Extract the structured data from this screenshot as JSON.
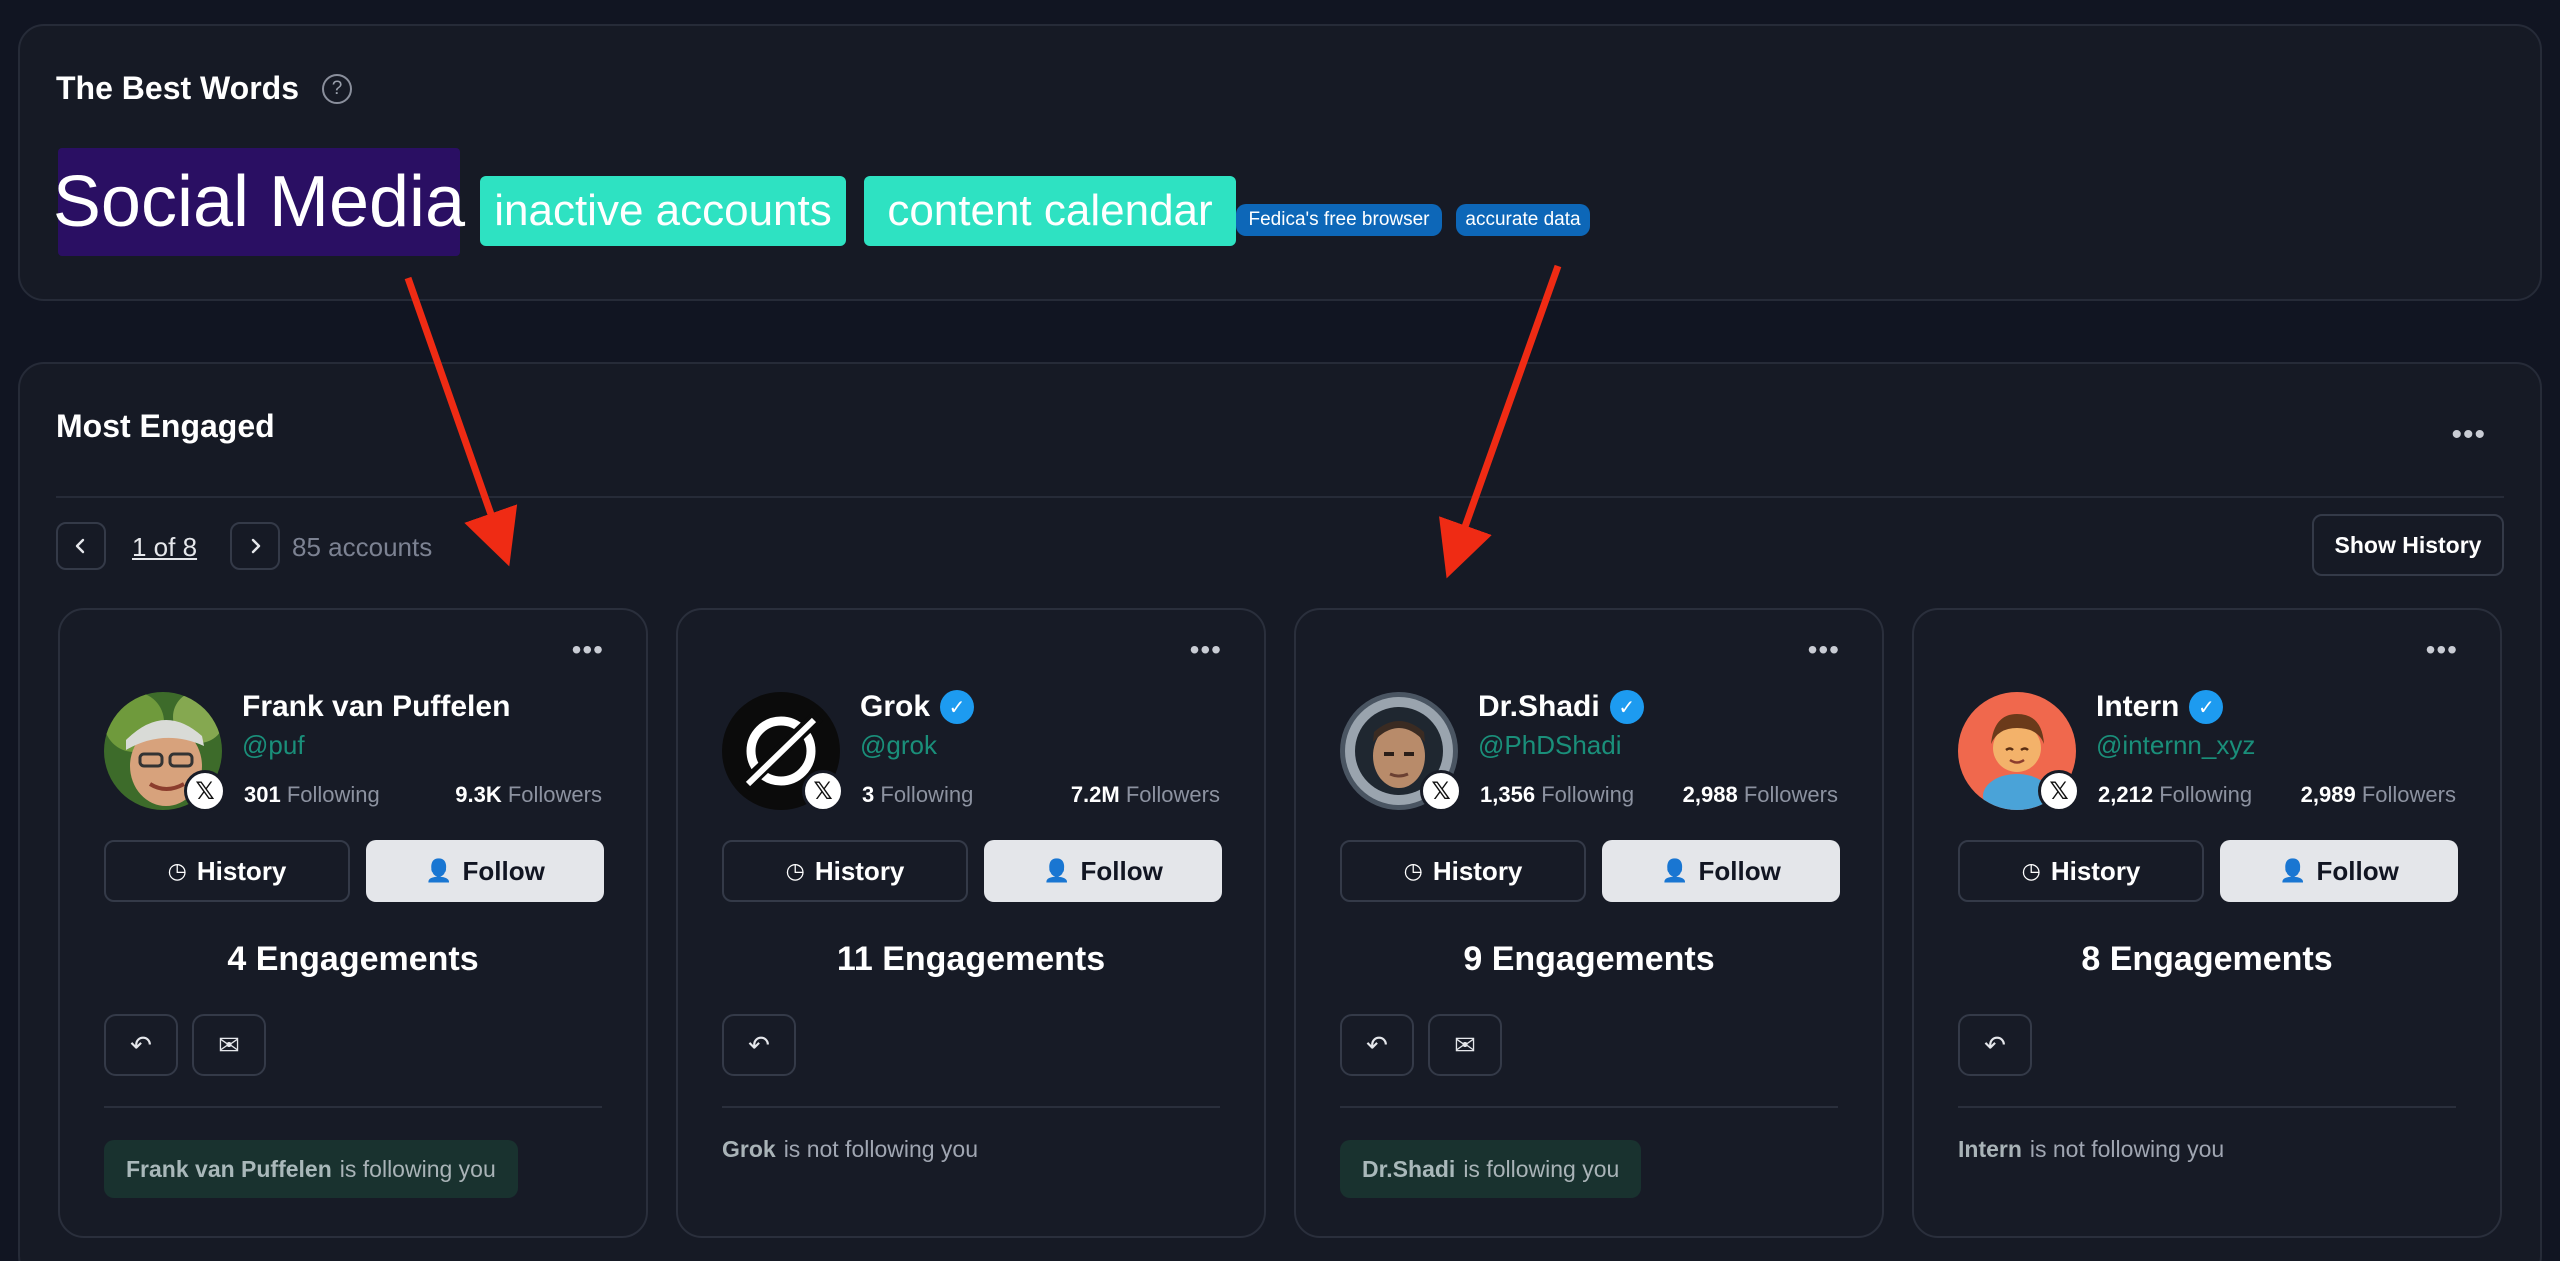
{
  "words_panel": {
    "title": "The Best Words",
    "help_icon": "question-circle-icon",
    "words": [
      {
        "text": "Social Media",
        "bg": "#2a0f63"
      },
      {
        "text": "inactive accounts",
        "bg": "#2ee2c2"
      },
      {
        "text": "content calendar",
        "bg": "#2ee2c2"
      },
      {
        "text": "Fedica's free browser",
        "bg": "#0d67b8"
      },
      {
        "text": "accurate data",
        "bg": "#0d67b8"
      }
    ]
  },
  "engaged_panel": {
    "title": "Most Engaged",
    "menu_icon": "ellipsis-icon",
    "pager": {
      "label": "1 of 8",
      "prev_icon": "chevron-left-icon",
      "next_icon": "chevron-right-icon"
    },
    "accounts": "85 accounts",
    "show_history": "Show History",
    "cards": [
      {
        "name": "Frank van Puffelen",
        "verified": false,
        "handle": "@puf",
        "following_count": "301",
        "following_label": "Following",
        "followers_count": "9.3K",
        "followers_label": "Followers",
        "history_label": "History",
        "follow_label": "Follow",
        "engagements": "4 Engagements",
        "has_mail": true,
        "status_name": "Frank van Puffelen",
        "status_text": "is following you",
        "is_following": true
      },
      {
        "name": "Grok",
        "verified": true,
        "handle": "@grok",
        "following_count": "3",
        "following_label": "Following",
        "followers_count": "7.2M",
        "followers_label": "Followers",
        "history_label": "History",
        "follow_label": "Follow",
        "engagements": "11 Engagements",
        "has_mail": false,
        "status_name": "Grok",
        "status_text": "is not following you",
        "is_following": false
      },
      {
        "name": "Dr.Shadi",
        "verified": true,
        "handle": "@PhDShadi",
        "following_count": "1,356",
        "following_label": "Following",
        "followers_count": "2,988",
        "followers_label": "Followers",
        "history_label": "History",
        "follow_label": "Follow",
        "engagements": "9 Engagements",
        "has_mail": true,
        "status_name": "Dr.Shadi",
        "status_text": "is following you",
        "is_following": true
      },
      {
        "name": "Intern",
        "verified": true,
        "handle": "@internn_xyz",
        "following_count": "2,212",
        "following_label": "Following",
        "followers_count": "2,989",
        "followers_label": "Followers",
        "history_label": "History",
        "follow_label": "Follow",
        "engagements": "8 Engagements",
        "has_mail": false,
        "status_name": "Intern",
        "status_text": "is not following you",
        "is_following": false
      }
    ]
  },
  "colors": {
    "background": "#111522",
    "panel": "#161a25",
    "handle": "#1a8f7a",
    "verified": "#1d9bf0",
    "annotation_arrow": "#ef2b14"
  }
}
